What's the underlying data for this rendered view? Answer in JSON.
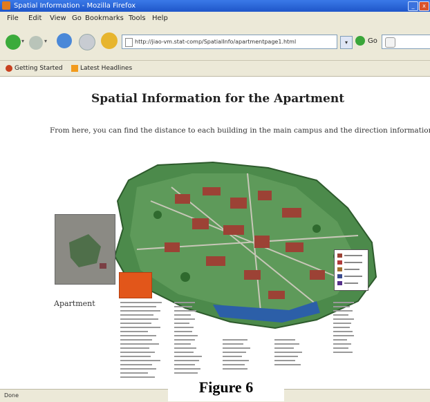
{
  "window": {
    "title": "Spatial Information - Mozilla Firefox"
  },
  "menu": {
    "items": [
      "File",
      "Edit",
      "View",
      "Go",
      "Bookmarks",
      "Tools",
      "Help"
    ]
  },
  "toolbar": {
    "url": "http://jiao-vm.stat-comp/SpatialInfo/apartmentpage1.html",
    "go_label": "Go",
    "search_placeholder": "G"
  },
  "bookmarks": {
    "items": [
      "Getting Started",
      "Latest Headlines"
    ]
  },
  "page": {
    "heading": "Spatial Information for the Apartment",
    "intro": "From here, you can find the distance to each building in the main campus and the direction information.",
    "photo_caption": "Apartment"
  },
  "status": {
    "text": "Done"
  },
  "figure": {
    "label": "Figure 6"
  },
  "colors": {
    "titlebar": "#2a62d8",
    "chrome": "#ece9d8",
    "map_grass": "#4c8a4b",
    "building": "#9c4235",
    "legend_orange": "#e2561a",
    "water": "#2c5fa8"
  }
}
